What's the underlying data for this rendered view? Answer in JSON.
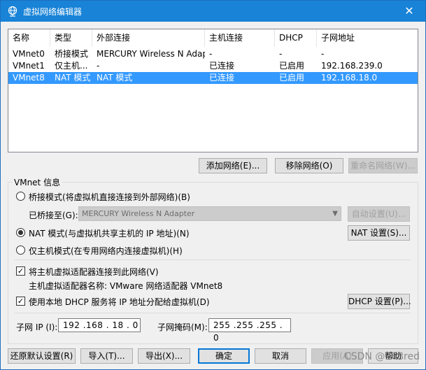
{
  "window": {
    "title": "虚拟网络编辑器",
    "close_glyph": "✕",
    "title_color": "#1883d7"
  },
  "netlist": {
    "columns": [
      "名称",
      "类型",
      "外部连接",
      "主机连接",
      "DHCP",
      "子网地址"
    ],
    "rows": [
      {
        "name": "VMnet0",
        "type": "桥接模式",
        "external": "MERCURY Wireless N Adapter",
        "host": "-",
        "dhcp": "-",
        "subnet": "-",
        "selected": false
      },
      {
        "name": "VMnet1",
        "type": "仅主机...",
        "external": "-",
        "host": "已连接",
        "dhcp": "已启用",
        "subnet": "192.168.239.0",
        "selected": false
      },
      {
        "name": "VMnet8",
        "type": "NAT 模式",
        "external": "NAT 模式",
        "host": "已连接",
        "dhcp": "已启用",
        "subnet": "192.168.18.0",
        "selected": true
      }
    ],
    "selection_color": "#3399ff"
  },
  "list_buttons": {
    "add": "添加网络(E)...",
    "remove": "移除网络(O)",
    "rename": "重命名网络(W)..."
  },
  "vmnet_info": {
    "group_title": "VMnet 信息",
    "bridged_label": "桥接模式(将虚拟机直接连接到外部网络)(B)",
    "bridged_to_label": "已桥接至(G):",
    "bridged_to_value": "MERCURY Wireless N Adapter",
    "auto_settings": "自动设置(U)...",
    "nat_label": "NAT 模式(与虚拟机共享主机的 IP 地址)(N)",
    "nat_settings": "NAT 设置(S)...",
    "hostonly_label": "仅主机模式(在专用网络内连接虚拟机)(H)",
    "selected_mode": "nat",
    "connect_adapter_label": "将主机虚拟适配器连接到此网络(V)",
    "connect_adapter_checked": true,
    "adapter_name_label": "主机虚拟适配器名称: VMware 网络适配器 VMnet8",
    "use_dhcp_label": "使用本地 DHCP 服务将 IP 地址分配给虚拟机(D)",
    "use_dhcp_checked": true,
    "dhcp_settings": "DHCP 设置(P)...",
    "subnet_ip_label": "子网 IP (I):",
    "subnet_ip_value": "192 .168 . 18 . 0",
    "subnet_mask_label": "子网掩码(M):",
    "subnet_mask_value": "255 .255 .255 . 0"
  },
  "footer": {
    "restore": "还原默认设置(R)",
    "import": "导入(T)...",
    "export": "导出(X)...",
    "ok": "确定",
    "cancel": "取消",
    "apply": "应用(A)",
    "help": "帮助"
  },
  "watermark": "CSDN @168red"
}
